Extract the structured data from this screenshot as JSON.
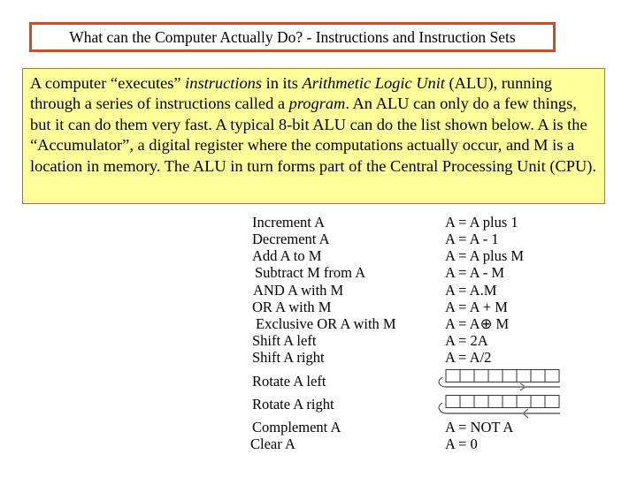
{
  "title": "What can the Computer Actually Do? - Instructions and Instruction Sets",
  "intro": {
    "s1": "A computer “executes” ",
    "s1_em": "instructions",
    "s2": " in its ",
    "s2_em": "Arithmetic Logic Unit",
    "s3": " (ALU), running through a series of instructions called a ",
    "s3_em": "program",
    "s4": ". An ALU can only do a few things, but it can do them very fast. A typical 8-bit ALU can do the list shown below. A is the “Accumulator”, a digital register where the computations actually occur, and M is a location in memory. The ALU in turn forms part of the Central Processing Unit (CPU)."
  },
  "colors": {
    "title_border": "#d9481f",
    "intro_background": "#ffff99",
    "intro_border": "#c66a3a"
  },
  "operations": [
    {
      "name": "Increment A",
      "result": "A = A plus 1"
    },
    {
      "name": "Decrement A",
      "result": "A = A - 1"
    },
    {
      "name": "Add A to M",
      "result": "A = A plus M"
    },
    {
      "name": "Subtract M from A",
      "result": "A = A - M"
    },
    {
      "name": "AND A with M",
      "result": "A = A.M"
    },
    {
      "name": "OR A with M",
      "result": "A = A + M"
    },
    {
      "name": "Exclusive OR A with M",
      "result": "A = A⊕ M"
    },
    {
      "name": "Shift A left",
      "result": "A = 2A"
    },
    {
      "name": "Shift A right",
      "result": "A = A/2"
    },
    {
      "name": "Rotate A left",
      "result": "",
      "diagram": "rotate-left-register-icon"
    },
    {
      "name": "Rotate A right",
      "result": "",
      "diagram": "rotate-right-register-icon"
    },
    {
      "name": "Complement A",
      "result": "A = NOT A"
    },
    {
      "name": "Clear A",
      "result": "A = 0"
    }
  ]
}
